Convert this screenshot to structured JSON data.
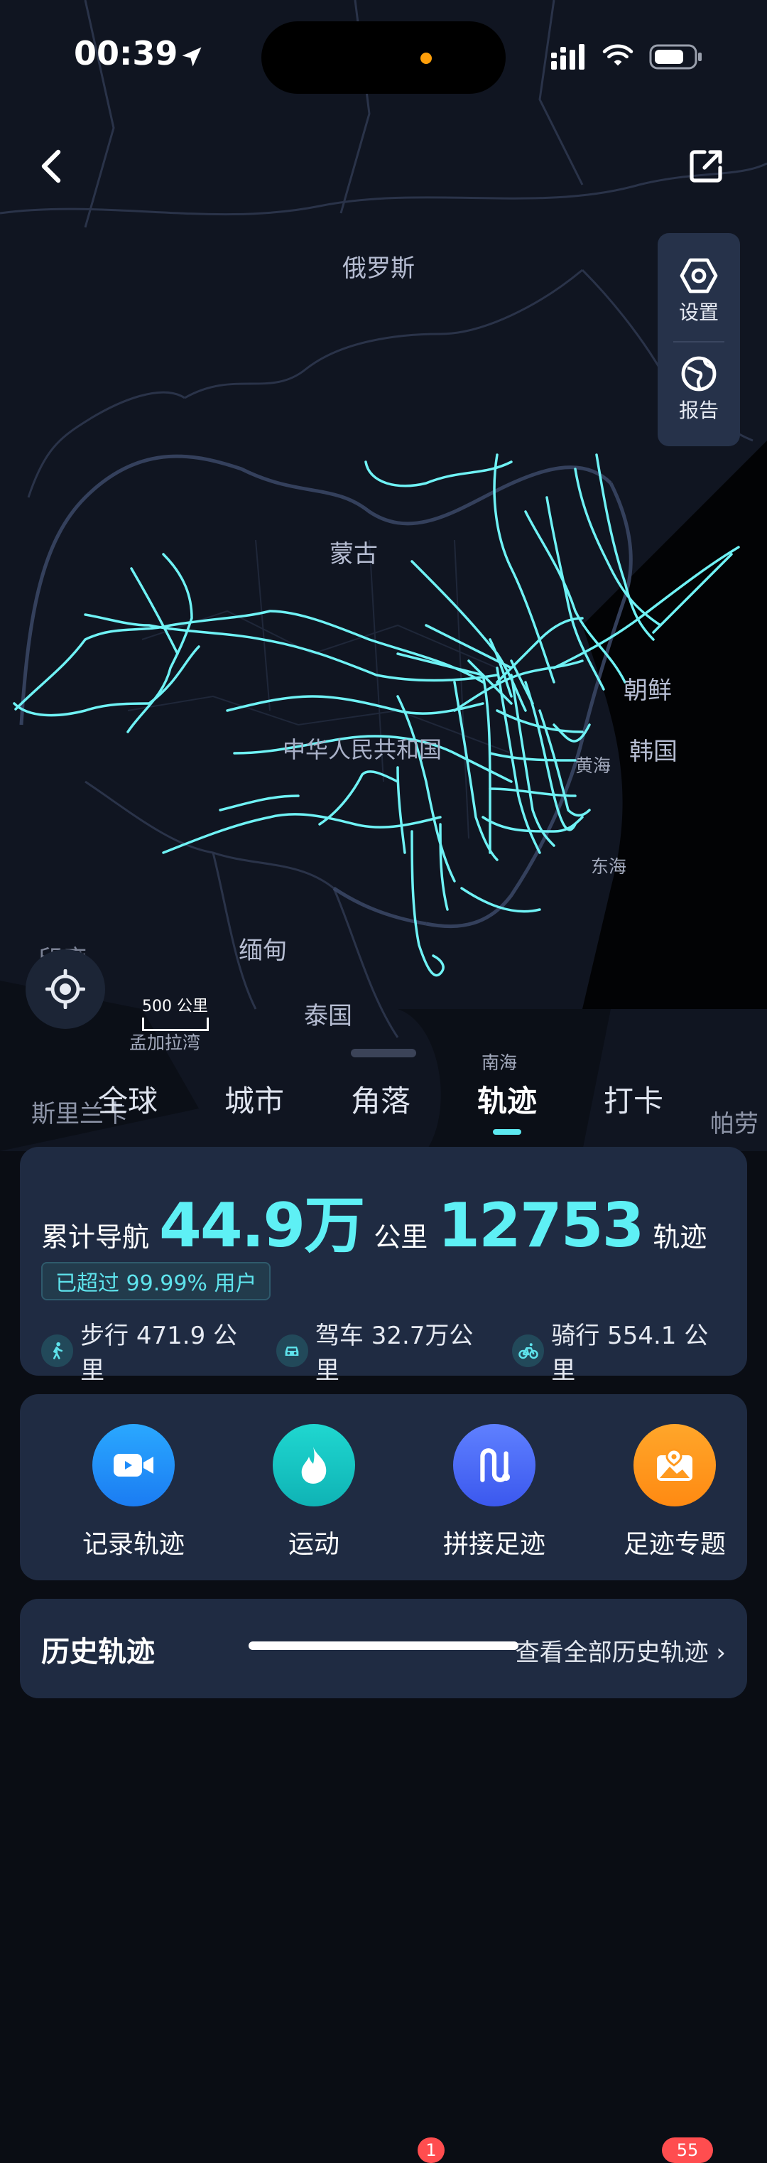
{
  "status_bar": {
    "time": "00:39"
  },
  "map": {
    "labels": {
      "russia": "俄罗斯",
      "mongolia": "蒙古",
      "china": "中华人民共和国",
      "north_korea": "朝鲜",
      "south_korea": "韩国",
      "yellow_sea": "黄海",
      "east_sea": "东海",
      "myanmar": "缅甸",
      "thailand": "泰国",
      "south_sea": "南海",
      "bay_of_bengal": "孟加拉湾",
      "sri_lanka": "斯里兰卡",
      "palau": "帕劳",
      "india_partial": "印度"
    },
    "scale_label": "500 公里",
    "track_color": "#6ff2f5"
  },
  "side_panel": {
    "settings_label": "设置",
    "report_label": "报告"
  },
  "tabs": [
    {
      "label": "全球"
    },
    {
      "label": "城市"
    },
    {
      "label": "角落",
      "badge": "1"
    },
    {
      "label": "轨迹"
    },
    {
      "label": "打卡",
      "badge": "55"
    }
  ],
  "active_tab": "轨迹",
  "stats": {
    "prefix": "累计导航",
    "distance_value": "44.9万",
    "distance_unit": "公里",
    "tracks_value": "12753",
    "tracks_unit": "轨迹",
    "rank": "已超过 99.99% 用户",
    "walk": "步行 471.9 公里",
    "drive": "驾车 32.7万公里",
    "ride": "骑行 554.1 公里"
  },
  "actions": [
    {
      "label": "记录轨迹",
      "color": "#1f9bff"
    },
    {
      "label": "运动",
      "color": "#14c9c9"
    },
    {
      "label": "拼接足迹",
      "color": "#4c6bff"
    },
    {
      "label": "足迹专题",
      "color": "#ff9a1f"
    }
  ],
  "history": {
    "title": "历史轨迹",
    "view_all": "查看全部历史轨迹"
  }
}
